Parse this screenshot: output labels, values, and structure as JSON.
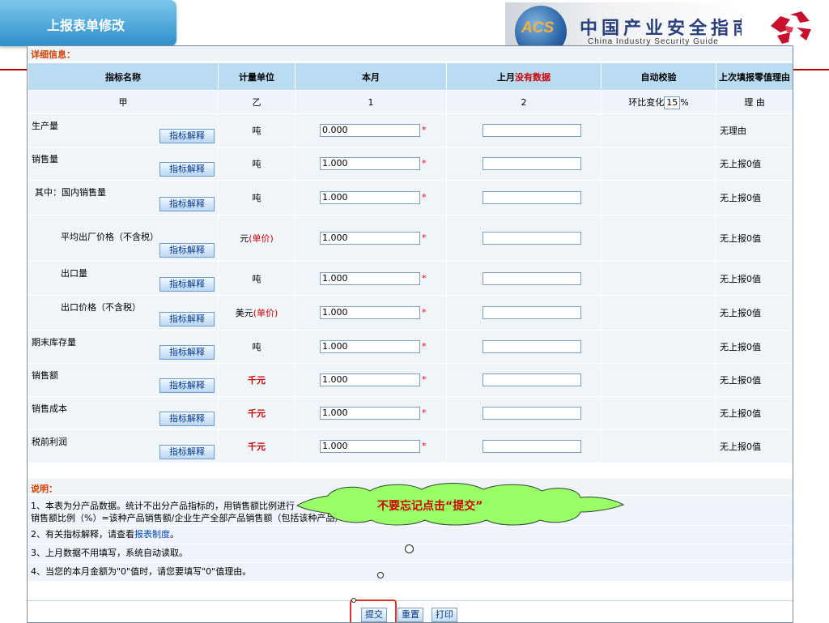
{
  "header": {
    "title": "上报表单修改",
    "logo_badge": "ACS",
    "logo_title_cn": "中国产业安全指南",
    "logo_title_en": "China Industry Security Guide"
  },
  "form": {
    "section_label": "详细信息：",
    "columns": {
      "name": "指标名称",
      "unit": "计量单位",
      "current": "本月",
      "last_prefix": "上月",
      "last_nodata": "没有数据",
      "auto_check": "自动校验",
      "reason": "上次填报零值理由"
    },
    "subheader": {
      "name": "甲",
      "unit": "乙",
      "current": "1",
      "last": "2",
      "auto_prefix": "环比变化",
      "auto_pct_value": "15",
      "auto_suffix": "%",
      "reason": "理 由"
    },
    "explain_label": "指标解释",
    "required_mark": "*",
    "rows": [
      {
        "name": "生产量",
        "unit": "吨",
        "current": "0.000",
        "reason": "无理由"
      },
      {
        "name": "销售量",
        "unit": "吨",
        "current": "1.000",
        "reason": "无上报0值"
      },
      {
        "name": "其中：国内销售量",
        "unit": "吨",
        "current": "1.000",
        "reason": "无上报0值"
      },
      {
        "name": "平均出厂价格（不含税）",
        "unit_prefix": "元",
        "unit_red": "(单价)",
        "current": "1.000",
        "reason": "无上报0值"
      },
      {
        "name": "出口量",
        "unit": "吨",
        "current": "1.000",
        "reason": "无上报0值"
      },
      {
        "name": "出口价格（不含税）",
        "unit_prefix": "美元",
        "unit_red": "(单价)",
        "current": "1.000",
        "reason": "无上报0值"
      },
      {
        "name": "期末库存量",
        "unit": "吨",
        "current": "1.000",
        "reason": "无上报0值"
      },
      {
        "name": "销售额",
        "unit": "千元",
        "current": "1.000",
        "reason": "无上报0值"
      },
      {
        "name": "销售成本",
        "unit": "千元",
        "current": "1.000",
        "reason": "无上报0值"
      },
      {
        "name": "税前利润",
        "unit": "千元",
        "current": "1.000",
        "reason": "无上报0值"
      }
    ]
  },
  "notes": {
    "heading": "说明：",
    "note1_line1": "1、本表为分产品数据。统计不出分产品指标的，用销售额比例进行",
    "note1_line2": "销售额比例（%）=该种产品销售额/企业生产全部产品销售额（包括该种产品）",
    "note2_prefix": "2、有关指标解释，请查看",
    "note2_link": "报表制度",
    "note2_suffix": "。",
    "note3": "3、上月数据不用填写，系统自动读取。",
    "note4": "4、当您的本月金额为\"0\"值时，请您要填写\"0\"值理由。"
  },
  "callout": "不要忘记点击“提交”",
  "actions": {
    "submit": "提交",
    "reset": "重置",
    "print": "打印"
  },
  "colors": {
    "header_blue": "#2f90cb",
    "table_header": "#b9dcf3",
    "accent_red": "#cc0000",
    "callout_green": "#99ff66"
  }
}
